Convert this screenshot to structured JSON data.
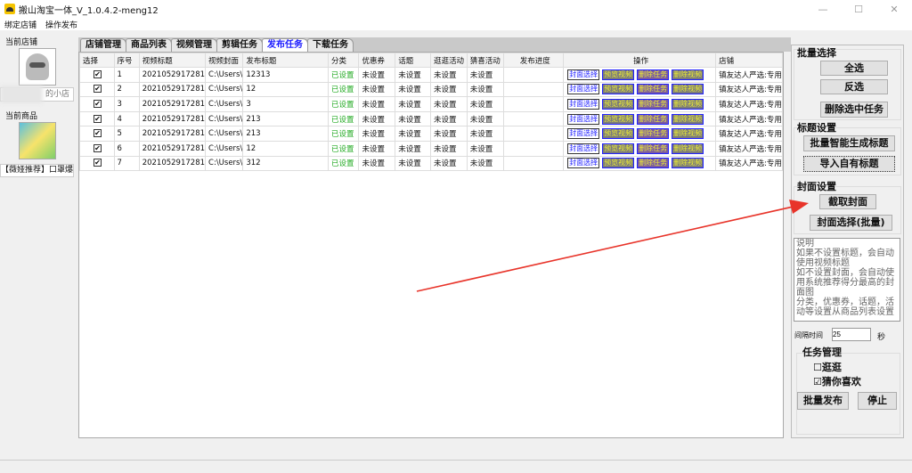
{
  "window": {
    "title": "搬山淘宝一体_V_1.0.4.2-meng12",
    "min": "—",
    "max": "☐",
    "close": "✕"
  },
  "menu": [
    "绑定店铺",
    "操作发布"
  ],
  "left": {
    "current_shop_label": "当前店铺",
    "shop_name": "的小店",
    "current_product_label": "当前商品",
    "product_name": "【薇娅推荐】口罩爆珠"
  },
  "tabs": [
    "店铺管理",
    "商品列表",
    "视频管理",
    "剪辑任务",
    "发布任务",
    "下载任务"
  ],
  "active_tab": "发布任务",
  "table": {
    "columns": [
      "选择",
      "序号",
      "视频标题",
      "视频封面",
      "发布标题",
      "分类",
      "优惠券",
      "话题",
      "逛逛活动",
      "猜喜活动",
      "发布进度",
      "操作",
      "店铺"
    ],
    "ops": [
      "封面选择",
      "预览视频",
      "删除任务",
      "删除视频"
    ],
    "rows": [
      {
        "checked": true,
        "no": "1",
        "video_title": "2021052917281",
        "cover": "C:\\Users\\",
        "pub_title": "12313",
        "category": "已设置",
        "coupon": "未设置",
        "topic": "未设置",
        "guang": "未设置",
        "caixi": "未设置",
        "progress": "",
        "shop": "镇友达人严选:专用"
      },
      {
        "checked": true,
        "no": "2",
        "video_title": "2021052917281",
        "cover": "C:\\Users\\",
        "pub_title": "12",
        "category": "已设置",
        "coupon": "未设置",
        "topic": "未设置",
        "guang": "未设置",
        "caixi": "未设置",
        "progress": "",
        "shop": "镇友达人严选:专用"
      },
      {
        "checked": true,
        "no": "3",
        "video_title": "2021052917281",
        "cover": "C:\\Users\\",
        "pub_title": "3",
        "category": "已设置",
        "coupon": "未设置",
        "topic": "未设置",
        "guang": "未设置",
        "caixi": "未设置",
        "progress": "",
        "shop": "镇友达人严选:专用"
      },
      {
        "checked": true,
        "no": "4",
        "video_title": "2021052917281",
        "cover": "C:\\Users\\",
        "pub_title": "213",
        "category": "已设置",
        "coupon": "未设置",
        "topic": "未设置",
        "guang": "未设置",
        "caixi": "未设置",
        "progress": "",
        "shop": "镇友达人严选:专用"
      },
      {
        "checked": true,
        "no": "5",
        "video_title": "2021052917281",
        "cover": "C:\\Users\\",
        "pub_title": "213",
        "category": "已设置",
        "coupon": "未设置",
        "topic": "未设置",
        "guang": "未设置",
        "caixi": "未设置",
        "progress": "",
        "shop": "镇友达人严选:专用"
      },
      {
        "checked": true,
        "no": "6",
        "video_title": "2021052917281",
        "cover": "C:\\Users\\",
        "pub_title": "12",
        "category": "已设置",
        "coupon": "未设置",
        "topic": "未设置",
        "guang": "未设置",
        "caixi": "未设置",
        "progress": "",
        "shop": "镇友达人严选:专用"
      },
      {
        "checked": true,
        "no": "7",
        "video_title": "2021052917281",
        "cover": "C:\\Users\\",
        "pub_title": "312",
        "category": "已设置",
        "coupon": "未设置",
        "topic": "未设置",
        "guang": "未设置",
        "caixi": "未设置",
        "progress": "",
        "shop": "镇友达人严选:专用"
      }
    ]
  },
  "right": {
    "batch_select": "批量选择",
    "select_all": "全选",
    "invert": "反选",
    "delete_selected": "删除选中任务",
    "title_settings": "标题设置",
    "gen_titles": "批量智能生成标题",
    "import_titles": "导入自有标题",
    "cover_settings": "封面设置",
    "capture_cover": "截取封面",
    "cover_batch": "封面选择(批量)",
    "note": "说明\n如果不设置标题，会自动使用视频标题\n如不设置封面，会自动使用系统推荐得分最高的封面图\n分类，优惠券，话题，活动等设置从商品列表设置",
    "interval_label": "间隔时间",
    "interval_value": "25",
    "interval_unit": "秒",
    "task_mgmt": "任务管理",
    "opt_guang": "逛逛",
    "opt_guang_checked": false,
    "opt_cainixihuan": "猜你喜欢",
    "opt_cainixihuan_checked": true,
    "batch_publish": "批量发布",
    "stop": "停止"
  },
  "colors": {
    "active_tab": "#1a1aff",
    "set_status": "#22aa22",
    "arrow": "#e8342a"
  }
}
